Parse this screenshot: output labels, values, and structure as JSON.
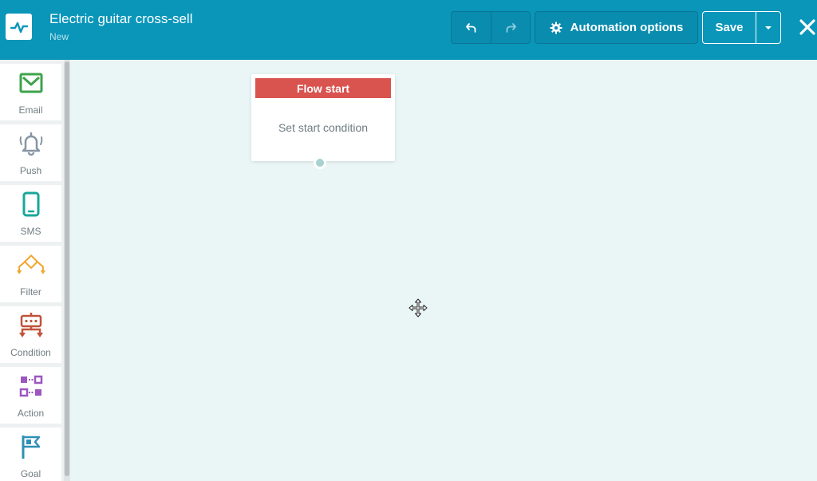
{
  "header": {
    "title": "Electric guitar cross-sell",
    "subtitle": "New",
    "options_label": "Automation options",
    "save_label": "Save",
    "colors": {
      "bar": "#0996b9",
      "accent": "#0a8cae"
    },
    "icons": [
      "pulse-icon",
      "undo-icon",
      "redo-icon",
      "gear-icon",
      "caret-down-icon",
      "close-icon"
    ]
  },
  "sidebar": {
    "items": [
      {
        "label": "Email",
        "icon": "envelope-icon",
        "color": "#3ea34b"
      },
      {
        "label": "Push",
        "icon": "bell-icon",
        "color": "#8795a3"
      },
      {
        "label": "SMS",
        "icon": "phone-icon",
        "color": "#1aa79a"
      },
      {
        "label": "Filter",
        "icon": "filter-icon",
        "color": "#f0a428"
      },
      {
        "label": "Condition",
        "icon": "condition-icon",
        "color": "#c0523a"
      },
      {
        "label": "Action",
        "icon": "action-icon",
        "color": "#9b57c0"
      },
      {
        "label": "Goal",
        "icon": "flag-icon",
        "color": "#2f8fb5"
      }
    ]
  },
  "canvas": {
    "flow_start": {
      "title": "Flow start",
      "body": "Set start condition",
      "color": "#d9534f"
    }
  }
}
